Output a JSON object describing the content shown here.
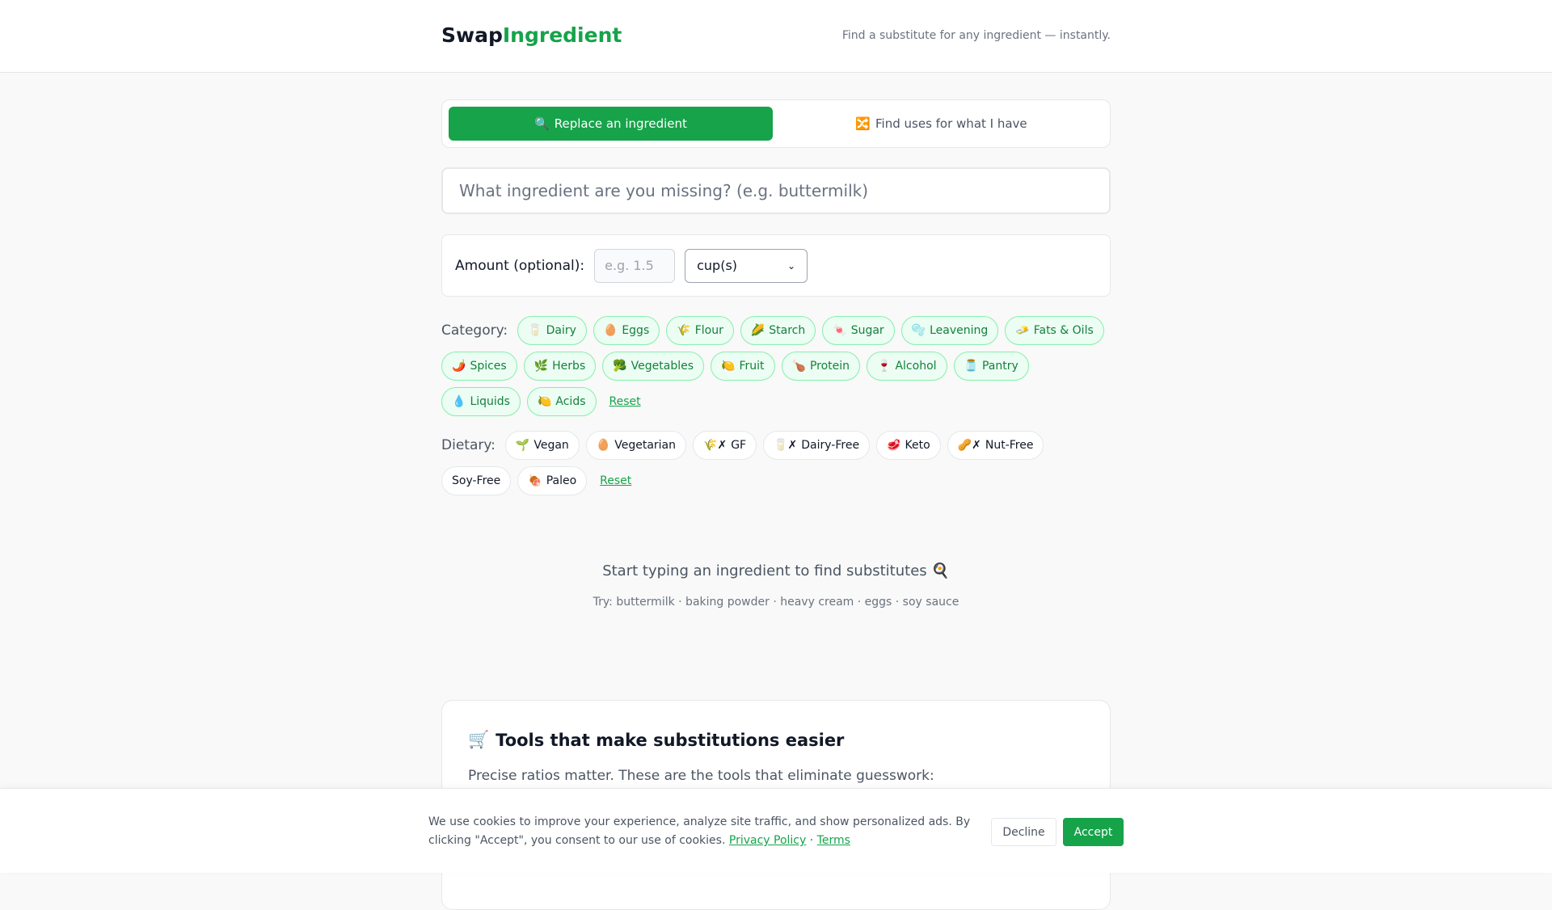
{
  "header": {
    "logo_part1": "Swap",
    "logo_part2": "Ingredient",
    "tagline": "Find a substitute for any ingredient — instantly."
  },
  "modes": [
    {
      "icon": "🔍",
      "label": "Replace an ingredient",
      "active": true
    },
    {
      "icon": "🔀",
      "label": "Find uses for what I have",
      "active": false
    }
  ],
  "search": {
    "placeholder": "What ingredient are you missing? (e.g. buttermilk)",
    "value": ""
  },
  "amount": {
    "label": "Amount (optional):",
    "placeholder": "e.g. 1.5",
    "unit_selected": "cup(s)"
  },
  "category": {
    "label": "Category:",
    "chips": [
      {
        "icon": "🥛",
        "label": "Dairy"
      },
      {
        "icon": "🥚",
        "label": "Eggs"
      },
      {
        "icon": "🌾",
        "label": "Flour"
      },
      {
        "icon": "🌽",
        "label": "Starch"
      },
      {
        "icon": "🍬",
        "label": "Sugar"
      },
      {
        "icon": "🫧",
        "label": "Leavening"
      },
      {
        "icon": "🧈",
        "label": "Fats & Oils"
      },
      {
        "icon": "🌶️",
        "label": "Spices"
      },
      {
        "icon": "🌿",
        "label": "Herbs"
      },
      {
        "icon": "🥦",
        "label": "Vegetables"
      },
      {
        "icon": "🍋",
        "label": "Fruit"
      },
      {
        "icon": "🍗",
        "label": "Protein"
      },
      {
        "icon": "🍷",
        "label": "Alcohol"
      },
      {
        "icon": "🫙",
        "label": "Pantry"
      },
      {
        "icon": "💧",
        "label": "Liquids"
      },
      {
        "icon": "🍋",
        "label": "Acids"
      }
    ],
    "reset_label": "Reset"
  },
  "dietary": {
    "label": "Dietary:",
    "chips": [
      {
        "icon": "🌱",
        "label": "Vegan"
      },
      {
        "icon": "🥚",
        "label": "Vegetarian"
      },
      {
        "icon": "🌾✗",
        "label": "GF"
      },
      {
        "icon": "🥛✗",
        "label": "Dairy-Free"
      },
      {
        "icon": "🥩",
        "label": "Keto"
      },
      {
        "icon": "🥜✗",
        "label": "Nut-Free"
      },
      {
        "icon": "",
        "label": "Soy-Free"
      },
      {
        "icon": "🍖",
        "label": "Paleo"
      }
    ],
    "reset_label": "Reset"
  },
  "empty_state": {
    "title": "Start typing an ingredient to find substitutes 🍳",
    "hint": "Try: buttermilk · baking powder · heavy cream · eggs · soy sauce"
  },
  "tools": {
    "icon": "🛒",
    "title": "Tools that make substitutions easier",
    "text": "Precise ratios matter. These are the tools that eliminate guesswork:"
  },
  "cookie": {
    "text": "We use cookies to improve your experience, analyze site traffic, and show personalized ads. By clicking \"Accept\", you consent to our use of cookies.",
    "privacy_label": "Privacy Policy",
    "separator": "·",
    "terms_label": "Terms",
    "decline_label": "Decline",
    "accept_label": "Accept"
  },
  "colors": {
    "brand": "#16a34a",
    "chip_bg": "#ecfdf3",
    "chip_border": "#86efac"
  }
}
